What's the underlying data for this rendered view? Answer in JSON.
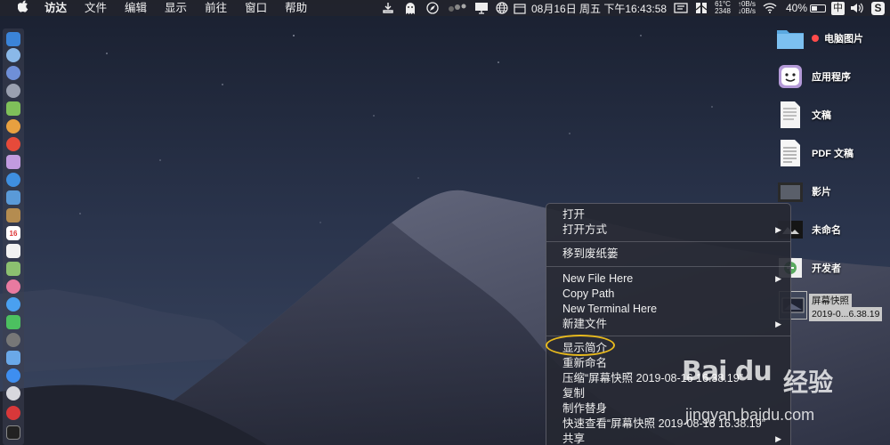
{
  "menubar": {
    "app_name": "访达",
    "menus": [
      "文件",
      "编辑",
      "显示",
      "前往",
      "窗口",
      "帮助"
    ],
    "clock": "08月16日 周五 下午16:43:58",
    "temperature": "61°C",
    "fan_rpm": "2348",
    "net_up": "↑0B/s",
    "net_down": "↓0B/s",
    "battery_percent": "40%",
    "battery_level": 0.4,
    "input_method": "中",
    "s_app": "S"
  },
  "desktop_items": [
    {
      "label": "电脑图片",
      "icon": "folder-icon"
    },
    {
      "label": "应用程序",
      "icon": "app-folder-icon"
    },
    {
      "label": "文稿",
      "icon": "document-icon"
    },
    {
      "label": "PDF 文稿",
      "icon": "pdf-document-icon"
    },
    {
      "label": "影片",
      "icon": "movies-icon"
    },
    {
      "label": "未命名",
      "icon": "image-file-icon"
    },
    {
      "label": "开发者",
      "icon": "developer-icon"
    }
  ],
  "selected_item": {
    "label_line1": "屏幕快照",
    "label_line2": "2019-0...6.38.19"
  },
  "tag_color": "#ff4b4b",
  "context_menu": {
    "items": [
      {
        "label": "打开"
      },
      {
        "label": "打开方式",
        "submenu": true
      },
      {
        "label": "移到废纸篓"
      },
      {
        "label": "New File Here",
        "submenu": true
      },
      {
        "label": "Copy Path"
      },
      {
        "label": "New Terminal Here"
      },
      {
        "label": "新建文件",
        "submenu": true
      },
      {
        "label": "显示简介"
      },
      {
        "label": "重新命名"
      },
      {
        "label": "压缩“屏幕快照 2019-08-16 16.38.19”"
      },
      {
        "label": "复制"
      },
      {
        "label": "制作替身"
      },
      {
        "label": "快速查看“屏幕快照 2019-08-16 16.38.19”"
      },
      {
        "label": "共享",
        "submenu": true
      }
    ],
    "submenu_arrow": "▶"
  },
  "watermark": {
    "logo": "Bai du",
    "text": "经验",
    "url": "jingyan.baidu.com"
  },
  "colors": {
    "highlight_ring": "#e7b91e",
    "menubar_bg": "#22242c"
  }
}
